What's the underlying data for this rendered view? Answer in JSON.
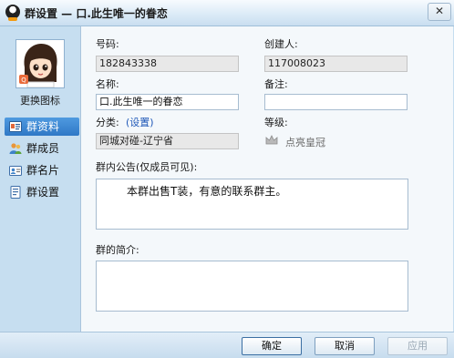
{
  "window": {
    "title": "群设置 — 口.此生唯一的眷恋",
    "close_symbol": "✕"
  },
  "sidebar": {
    "change_icon_label": "更换图标",
    "items": [
      {
        "label": "群资料",
        "icon": "group-info-icon",
        "active": true
      },
      {
        "label": "群成员",
        "icon": "members-icon",
        "active": false
      },
      {
        "label": "群名片",
        "icon": "name-card-icon",
        "active": false
      },
      {
        "label": "群设置",
        "icon": "settings-icon",
        "active": false
      }
    ]
  },
  "form": {
    "number_label": "号码:",
    "number_value": "182843338",
    "creator_label": "创建人:",
    "creator_value": "117008023",
    "name_label": "名称:",
    "name_value": "口.此生唯一的眷恋",
    "remark_label": "备注:",
    "remark_value": "",
    "category_label": "分类:",
    "category_link": "(设置)",
    "category_value": "同城对碰-辽宁省",
    "level_label": "等级:",
    "level_link": "点亮皇冠",
    "announcement_label": "群内公告(仅成员可见):",
    "announcement_value": "本群出售T装，有意的联系群主。",
    "intro_label": "群的简介:",
    "intro_value": ""
  },
  "buttons": {
    "ok": "确定",
    "cancel": "取消",
    "apply": "应用"
  },
  "colors": {
    "active_nav": "#3b86d6",
    "link": "#1f58b8",
    "sidebar_bg": "#c6def0"
  }
}
